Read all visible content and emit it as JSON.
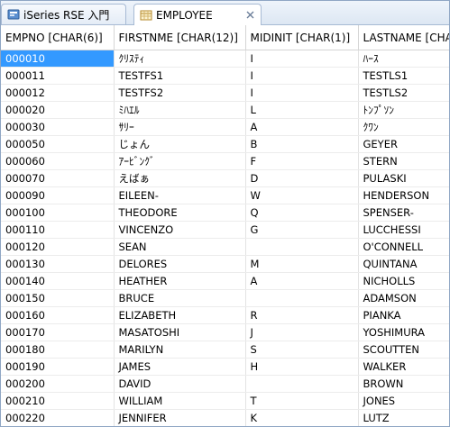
{
  "tabs": [
    {
      "label": "iSeries RSE 入門",
      "icon": "rse-perspective-icon",
      "active": false
    },
    {
      "label": "EMPLOYEE",
      "icon": "table-editor-icon",
      "active": true,
      "close_icon": "close-icon"
    }
  ],
  "table": {
    "columns": [
      "EMPNO [CHAR(6)]",
      "FIRSTNME [CHAR(12)]",
      "MIDINIT [CHAR(1)]",
      "LASTNAME [CHA"
    ],
    "rows": [
      [
        "000010",
        "ｸﾘｽﾃｨ",
        "I",
        "ﾊｰｽ"
      ],
      [
        "000011",
        "TESTFS1",
        "I",
        "TESTLS1"
      ],
      [
        "000012",
        "TESTFS2",
        "I",
        "TESTLS2"
      ],
      [
        "000020",
        "ﾐﾊｴﾙ",
        "L",
        "ﾄﾝﾌﾟｿﾝ"
      ],
      [
        "000030",
        "ｻﾘｰ",
        "A",
        "ｸﾜﾝ"
      ],
      [
        "000050",
        "じょん",
        "B",
        "GEYER"
      ],
      [
        "000060",
        "ｱｰﾋﾞﾝｸﾞ",
        "F",
        "STERN"
      ],
      [
        "000070",
        "えばぁ",
        "D",
        "PULASKI"
      ],
      [
        "000090",
        "EILEEN-",
        "W",
        "HENDERSON"
      ],
      [
        "000100",
        "THEODORE",
        "Q",
        "SPENSER-"
      ],
      [
        "000110",
        "VINCENZO",
        "G",
        "LUCCHESSI"
      ],
      [
        "000120",
        "SEAN",
        "",
        "O'CONNELL"
      ],
      [
        "000130",
        "DELORES",
        "M",
        "QUINTANA"
      ],
      [
        "000140",
        "HEATHER",
        "A",
        "NICHOLLS"
      ],
      [
        "000150",
        "BRUCE",
        "",
        "ADAMSON"
      ],
      [
        "000160",
        "ELIZABETH",
        "R",
        "PIANKA"
      ],
      [
        "000170",
        "MASATOSHI",
        "J",
        "YOSHIMURA"
      ],
      [
        "000180",
        "MARILYN",
        "S",
        "SCOUTTEN"
      ],
      [
        "000190",
        "JAMES",
        "H",
        "WALKER"
      ],
      [
        "000200",
        "DAVID",
        "",
        "BROWN"
      ],
      [
        "000210",
        "WILLIAM",
        "T",
        "JONES"
      ],
      [
        "000220",
        "JENNIFER",
        "K",
        "LUTZ"
      ]
    ],
    "selected_cell": {
      "row": 0,
      "col": 0
    }
  },
  "colors": {
    "selection": "#3399ff",
    "tab_border": "#a7bad4",
    "window_border": "#8fa6c4"
  }
}
